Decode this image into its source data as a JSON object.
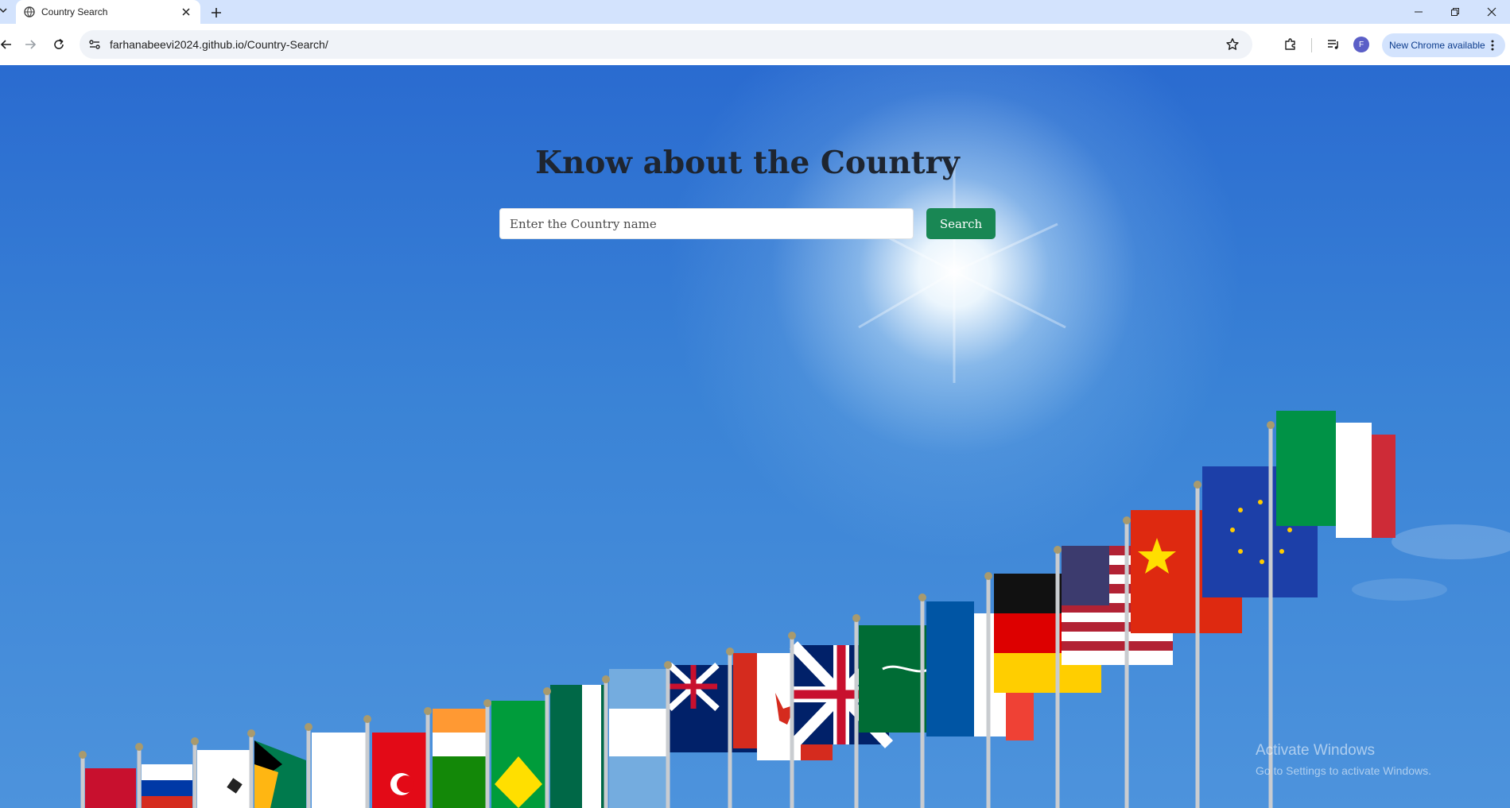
{
  "browser": {
    "tab_title": "Country Search",
    "url": "farhanabeevi2024.github.io/Country-Search/",
    "profile_initial": "F",
    "update_label": "New Chrome available"
  },
  "page": {
    "heading": "Know about the Country",
    "search_placeholder": "Enter the Country name",
    "search_value": "",
    "search_button": "Search"
  },
  "os_watermark": {
    "line1": "Activate Windows",
    "line2": "Go to Settings to activate Windows."
  },
  "colors": {
    "tab_strip": "#d3e3fd",
    "sky": "#3a83d6",
    "search_button": "#198754",
    "heading": "#1e2530"
  },
  "flags": [
    "Norway",
    "Russia",
    "South Korea",
    "South Africa",
    "Japan",
    "Turkey",
    "India",
    "Brazil",
    "Mexico",
    "Argentina",
    "Australia",
    "Canada",
    "United Kingdom",
    "Saudi Arabia",
    "France",
    "Germany",
    "United States",
    "China",
    "European Union",
    "Italy"
  ]
}
